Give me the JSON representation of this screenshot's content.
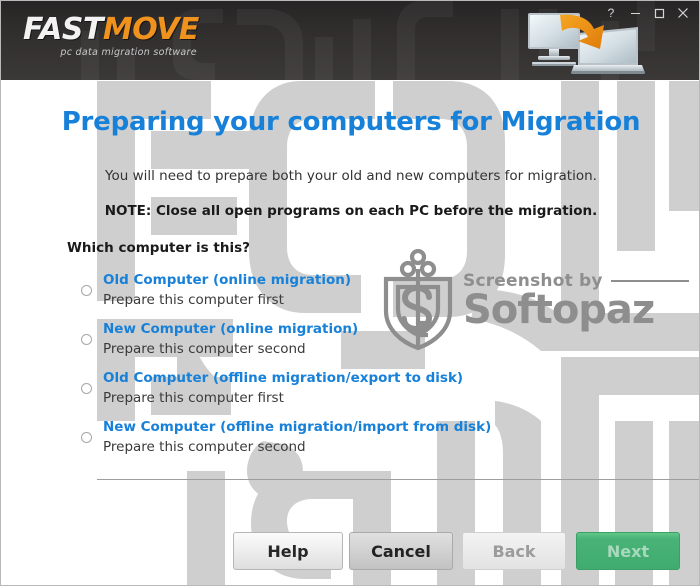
{
  "window": {
    "logo_primary": "FAST",
    "logo_secondary": "MOVE",
    "logo_tagline": "pc data migration software",
    "controls": [
      {
        "name": "help",
        "glyph": "?"
      },
      {
        "name": "minimize",
        "glyph": "─"
      },
      {
        "name": "maximize",
        "glyph": "□"
      },
      {
        "name": "close",
        "glyph": "✕"
      }
    ],
    "header_art_name": "desktop-to-laptop-migration-illustration"
  },
  "page": {
    "title": "Preparing your computers for Migration",
    "intro": "You will need to prepare both your old and new computers for migration.",
    "note": "NOTE: Close all open programs on each PC before the migration.",
    "question": "Which computer is this?"
  },
  "options": [
    {
      "title": "Old Computer (online migration)",
      "subtitle": "Prepare this computer first",
      "selected": false
    },
    {
      "title": "New Computer (online migration)",
      "subtitle": "Prepare this computer second",
      "selected": false
    },
    {
      "title": "Old Computer (offline migration/export to disk)",
      "subtitle": "Prepare this computer first",
      "selected": false
    },
    {
      "title": "New Computer (offline migration/import from disk)",
      "subtitle": "Prepare this computer second",
      "selected": false
    }
  ],
  "footer": {
    "help": "Help",
    "cancel": "Cancel",
    "back": "Back",
    "next": "Next"
  },
  "watermark": {
    "line1": "Screenshot by",
    "line2": "Softopaz",
    "logo_name": "softopaz-shield-key-logo"
  },
  "colors": {
    "title_blue": "#1780d8",
    "logo_orange": "#f0921e",
    "next_green": "#49b377",
    "header_dark": "#302d2d",
    "watermark_gray": "#8e8e8e",
    "bg_watermark_gray": "#cfcfcf"
  }
}
